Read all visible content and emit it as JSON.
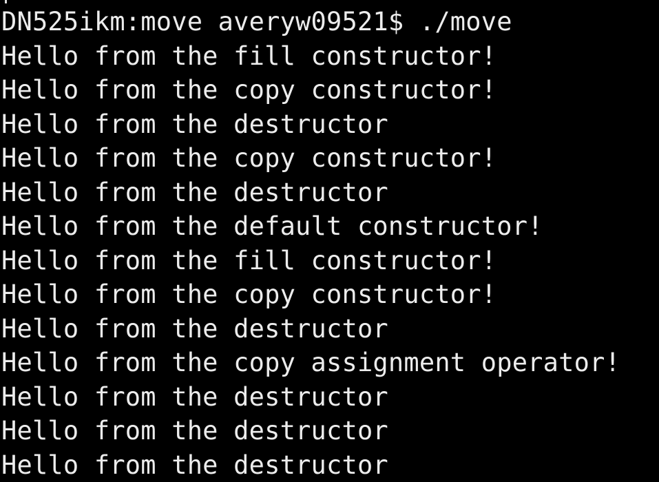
{
  "terminal": {
    "prompt_line": "DN525ikm:move averyw09521$ ./move",
    "output": [
      "Hello from the fill constructor!",
      "Hello from the copy constructor!",
      "Hello from the destructor",
      "Hello from the copy constructor!",
      "Hello from the destructor",
      "Hello from the default constructor!",
      "Hello from the fill constructor!",
      "Hello from the copy constructor!",
      "Hello from the destructor",
      "Hello from the copy assignment operator!",
      "Hello from the destructor",
      "Hello from the destructor",
      "Hello from the destructor"
    ]
  },
  "colors": {
    "background": "#000000",
    "foreground": "#ececec"
  }
}
